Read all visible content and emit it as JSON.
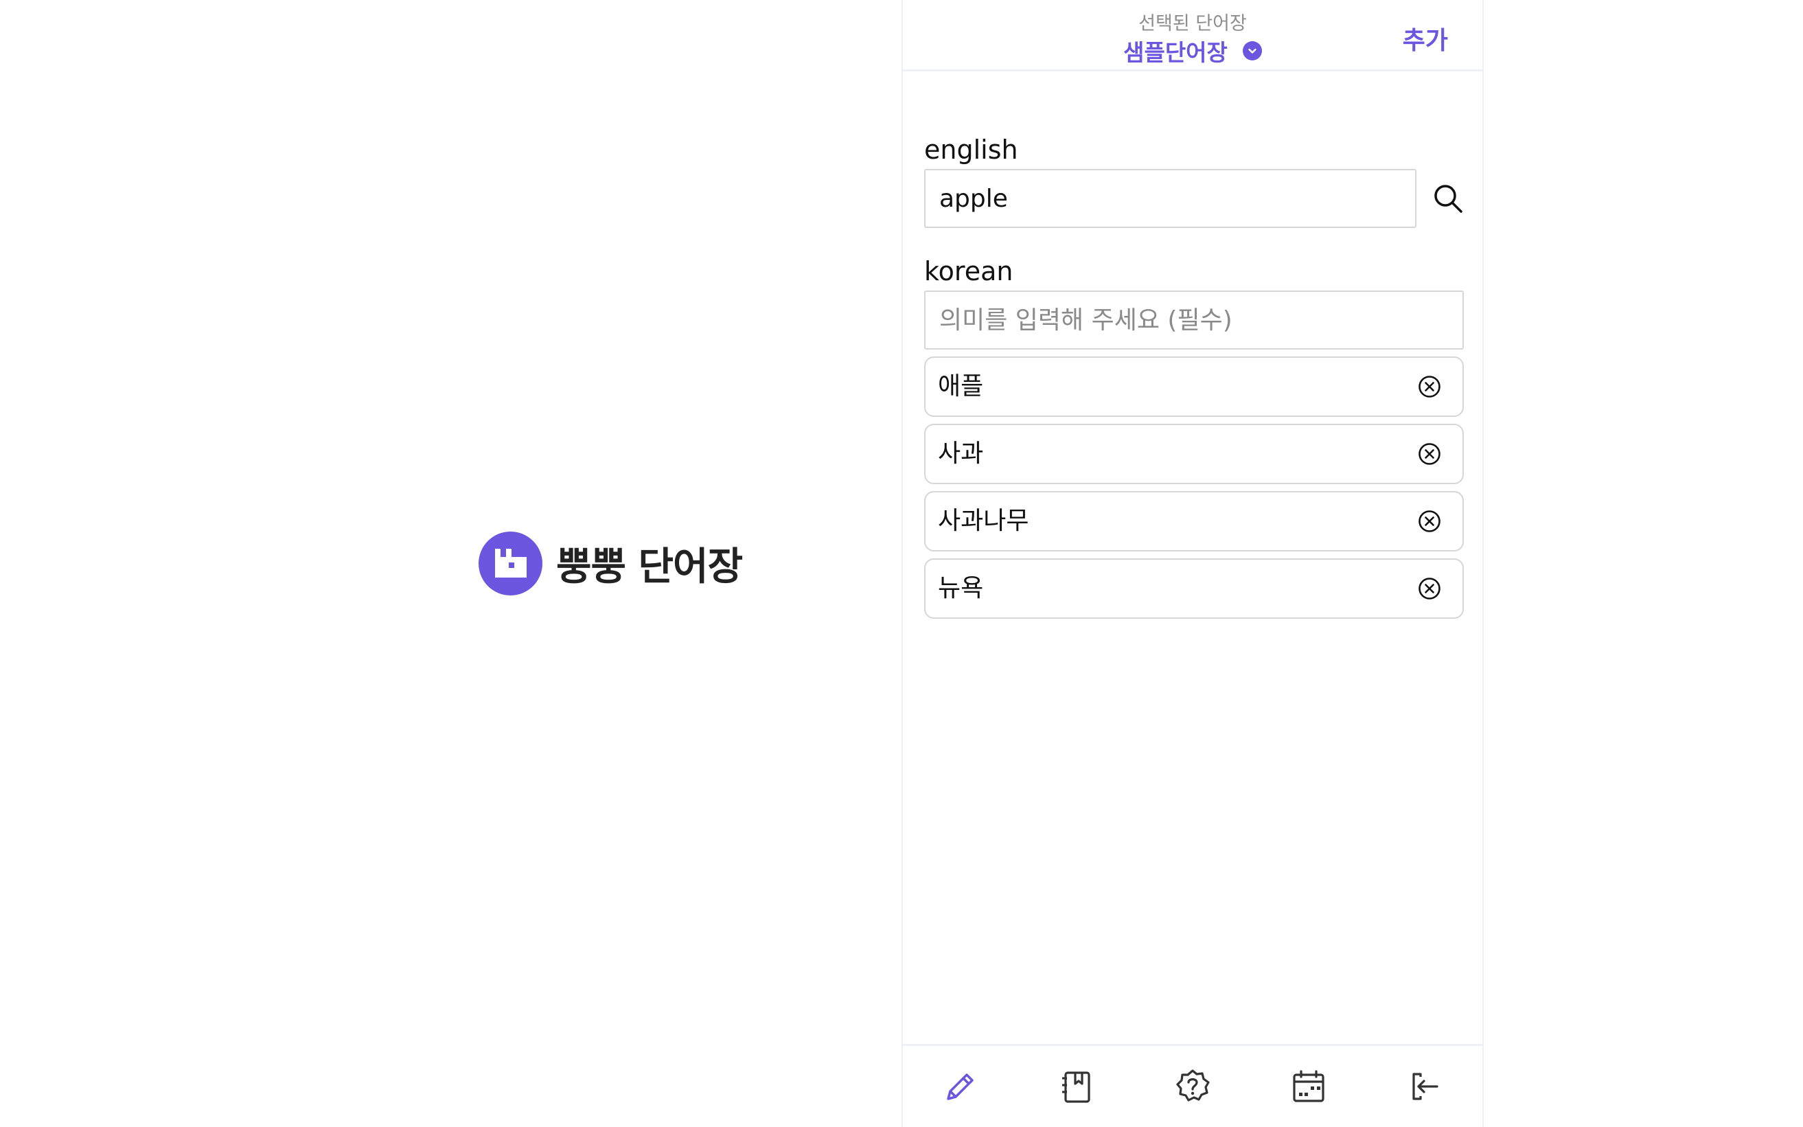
{
  "brand": {
    "name": "뿡뿡 단어장",
    "logo_icon": "brand-logo-icon",
    "color": "#6c56e0"
  },
  "header": {
    "subtitle": "선택된 단어장",
    "title": "샘플단어장",
    "dropdown_icon": "chevron-down-circle-icon",
    "add_label": "추가"
  },
  "form": {
    "english_label": "english",
    "english_value": "apple",
    "search_icon": "search-icon",
    "korean_label": "korean",
    "korean_placeholder": "의미를 입력해 주세요 (필수)",
    "korean_value": ""
  },
  "meanings": [
    {
      "text": "애플"
    },
    {
      "text": "사과"
    },
    {
      "text": "사과나무"
    },
    {
      "text": "뉴욕"
    }
  ],
  "nav": {
    "items": [
      {
        "icon": "pencil-icon",
        "active": true
      },
      {
        "icon": "notebook-icon",
        "active": false
      },
      {
        "icon": "quiz-icon",
        "active": false
      },
      {
        "icon": "calendar-icon",
        "active": false
      },
      {
        "icon": "logout-icon",
        "active": false
      }
    ]
  },
  "colors": {
    "accent": "#6c56e0",
    "icon_default": "#333333",
    "border": "#d6d6d6"
  }
}
